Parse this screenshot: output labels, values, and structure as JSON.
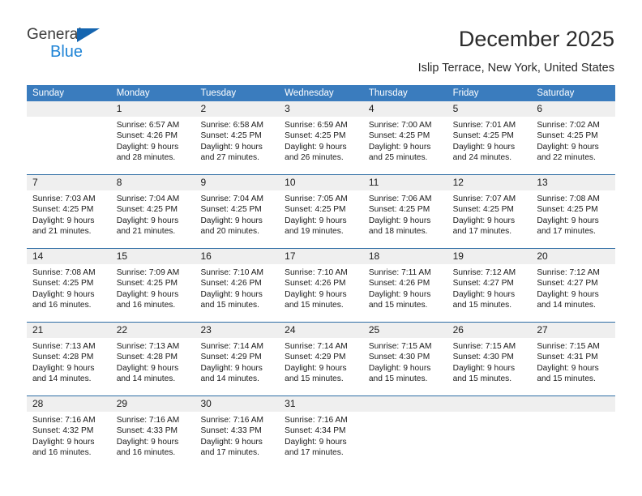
{
  "brand": {
    "name_part1": "General",
    "name_part2": "Blue"
  },
  "header": {
    "title": "December 2025",
    "subtitle": "Islip Terrace, New York, United States"
  },
  "calendar": {
    "weekdays": [
      "Sunday",
      "Monday",
      "Tuesday",
      "Wednesday",
      "Thursday",
      "Friday",
      "Saturday"
    ],
    "colors": {
      "header_background": "#3a7cbe",
      "header_text": "#ffffff",
      "row_divider": "#2e6da4",
      "day_band_background": "#efefef",
      "brand_blue": "#1f84d6",
      "brand_triangle": "#1565b0"
    },
    "weeks": [
      [
        {
          "day": "",
          "sunrise": "",
          "sunset": "",
          "daylight_line1": "",
          "daylight_line2": ""
        },
        {
          "day": "1",
          "sunrise": "Sunrise: 6:57 AM",
          "sunset": "Sunset: 4:26 PM",
          "daylight_line1": "Daylight: 9 hours",
          "daylight_line2": "and 28 minutes."
        },
        {
          "day": "2",
          "sunrise": "Sunrise: 6:58 AM",
          "sunset": "Sunset: 4:25 PM",
          "daylight_line1": "Daylight: 9 hours",
          "daylight_line2": "and 27 minutes."
        },
        {
          "day": "3",
          "sunrise": "Sunrise: 6:59 AM",
          "sunset": "Sunset: 4:25 PM",
          "daylight_line1": "Daylight: 9 hours",
          "daylight_line2": "and 26 minutes."
        },
        {
          "day": "4",
          "sunrise": "Sunrise: 7:00 AM",
          "sunset": "Sunset: 4:25 PM",
          "daylight_line1": "Daylight: 9 hours",
          "daylight_line2": "and 25 minutes."
        },
        {
          "day": "5",
          "sunrise": "Sunrise: 7:01 AM",
          "sunset": "Sunset: 4:25 PM",
          "daylight_line1": "Daylight: 9 hours",
          "daylight_line2": "and 24 minutes."
        },
        {
          "day": "6",
          "sunrise": "Sunrise: 7:02 AM",
          "sunset": "Sunset: 4:25 PM",
          "daylight_line1": "Daylight: 9 hours",
          "daylight_line2": "and 22 minutes."
        }
      ],
      [
        {
          "day": "7",
          "sunrise": "Sunrise: 7:03 AM",
          "sunset": "Sunset: 4:25 PM",
          "daylight_line1": "Daylight: 9 hours",
          "daylight_line2": "and 21 minutes."
        },
        {
          "day": "8",
          "sunrise": "Sunrise: 7:04 AM",
          "sunset": "Sunset: 4:25 PM",
          "daylight_line1": "Daylight: 9 hours",
          "daylight_line2": "and 21 minutes."
        },
        {
          "day": "9",
          "sunrise": "Sunrise: 7:04 AM",
          "sunset": "Sunset: 4:25 PM",
          "daylight_line1": "Daylight: 9 hours",
          "daylight_line2": "and 20 minutes."
        },
        {
          "day": "10",
          "sunrise": "Sunrise: 7:05 AM",
          "sunset": "Sunset: 4:25 PM",
          "daylight_line1": "Daylight: 9 hours",
          "daylight_line2": "and 19 minutes."
        },
        {
          "day": "11",
          "sunrise": "Sunrise: 7:06 AM",
          "sunset": "Sunset: 4:25 PM",
          "daylight_line1": "Daylight: 9 hours",
          "daylight_line2": "and 18 minutes."
        },
        {
          "day": "12",
          "sunrise": "Sunrise: 7:07 AM",
          "sunset": "Sunset: 4:25 PM",
          "daylight_line1": "Daylight: 9 hours",
          "daylight_line2": "and 17 minutes."
        },
        {
          "day": "13",
          "sunrise": "Sunrise: 7:08 AM",
          "sunset": "Sunset: 4:25 PM",
          "daylight_line1": "Daylight: 9 hours",
          "daylight_line2": "and 17 minutes."
        }
      ],
      [
        {
          "day": "14",
          "sunrise": "Sunrise: 7:08 AM",
          "sunset": "Sunset: 4:25 PM",
          "daylight_line1": "Daylight: 9 hours",
          "daylight_line2": "and 16 minutes."
        },
        {
          "day": "15",
          "sunrise": "Sunrise: 7:09 AM",
          "sunset": "Sunset: 4:25 PM",
          "daylight_line1": "Daylight: 9 hours",
          "daylight_line2": "and 16 minutes."
        },
        {
          "day": "16",
          "sunrise": "Sunrise: 7:10 AM",
          "sunset": "Sunset: 4:26 PM",
          "daylight_line1": "Daylight: 9 hours",
          "daylight_line2": "and 15 minutes."
        },
        {
          "day": "17",
          "sunrise": "Sunrise: 7:10 AM",
          "sunset": "Sunset: 4:26 PM",
          "daylight_line1": "Daylight: 9 hours",
          "daylight_line2": "and 15 minutes."
        },
        {
          "day": "18",
          "sunrise": "Sunrise: 7:11 AM",
          "sunset": "Sunset: 4:26 PM",
          "daylight_line1": "Daylight: 9 hours",
          "daylight_line2": "and 15 minutes."
        },
        {
          "day": "19",
          "sunrise": "Sunrise: 7:12 AM",
          "sunset": "Sunset: 4:27 PM",
          "daylight_line1": "Daylight: 9 hours",
          "daylight_line2": "and 15 minutes."
        },
        {
          "day": "20",
          "sunrise": "Sunrise: 7:12 AM",
          "sunset": "Sunset: 4:27 PM",
          "daylight_line1": "Daylight: 9 hours",
          "daylight_line2": "and 14 minutes."
        }
      ],
      [
        {
          "day": "21",
          "sunrise": "Sunrise: 7:13 AM",
          "sunset": "Sunset: 4:28 PM",
          "daylight_line1": "Daylight: 9 hours",
          "daylight_line2": "and 14 minutes."
        },
        {
          "day": "22",
          "sunrise": "Sunrise: 7:13 AM",
          "sunset": "Sunset: 4:28 PM",
          "daylight_line1": "Daylight: 9 hours",
          "daylight_line2": "and 14 minutes."
        },
        {
          "day": "23",
          "sunrise": "Sunrise: 7:14 AM",
          "sunset": "Sunset: 4:29 PM",
          "daylight_line1": "Daylight: 9 hours",
          "daylight_line2": "and 14 minutes."
        },
        {
          "day": "24",
          "sunrise": "Sunrise: 7:14 AM",
          "sunset": "Sunset: 4:29 PM",
          "daylight_line1": "Daylight: 9 hours",
          "daylight_line2": "and 15 minutes."
        },
        {
          "day": "25",
          "sunrise": "Sunrise: 7:15 AM",
          "sunset": "Sunset: 4:30 PM",
          "daylight_line1": "Daylight: 9 hours",
          "daylight_line2": "and 15 minutes."
        },
        {
          "day": "26",
          "sunrise": "Sunrise: 7:15 AM",
          "sunset": "Sunset: 4:30 PM",
          "daylight_line1": "Daylight: 9 hours",
          "daylight_line2": "and 15 minutes."
        },
        {
          "day": "27",
          "sunrise": "Sunrise: 7:15 AM",
          "sunset": "Sunset: 4:31 PM",
          "daylight_line1": "Daylight: 9 hours",
          "daylight_line2": "and 15 minutes."
        }
      ],
      [
        {
          "day": "28",
          "sunrise": "Sunrise: 7:16 AM",
          "sunset": "Sunset: 4:32 PM",
          "daylight_line1": "Daylight: 9 hours",
          "daylight_line2": "and 16 minutes."
        },
        {
          "day": "29",
          "sunrise": "Sunrise: 7:16 AM",
          "sunset": "Sunset: 4:33 PM",
          "daylight_line1": "Daylight: 9 hours",
          "daylight_line2": "and 16 minutes."
        },
        {
          "day": "30",
          "sunrise": "Sunrise: 7:16 AM",
          "sunset": "Sunset: 4:33 PM",
          "daylight_line1": "Daylight: 9 hours",
          "daylight_line2": "and 17 minutes."
        },
        {
          "day": "31",
          "sunrise": "Sunrise: 7:16 AM",
          "sunset": "Sunset: 4:34 PM",
          "daylight_line1": "Daylight: 9 hours",
          "daylight_line2": "and 17 minutes."
        },
        {
          "day": "",
          "sunrise": "",
          "sunset": "",
          "daylight_line1": "",
          "daylight_line2": ""
        },
        {
          "day": "",
          "sunrise": "",
          "sunset": "",
          "daylight_line1": "",
          "daylight_line2": ""
        },
        {
          "day": "",
          "sunrise": "",
          "sunset": "",
          "daylight_line1": "",
          "daylight_line2": ""
        }
      ]
    ]
  }
}
